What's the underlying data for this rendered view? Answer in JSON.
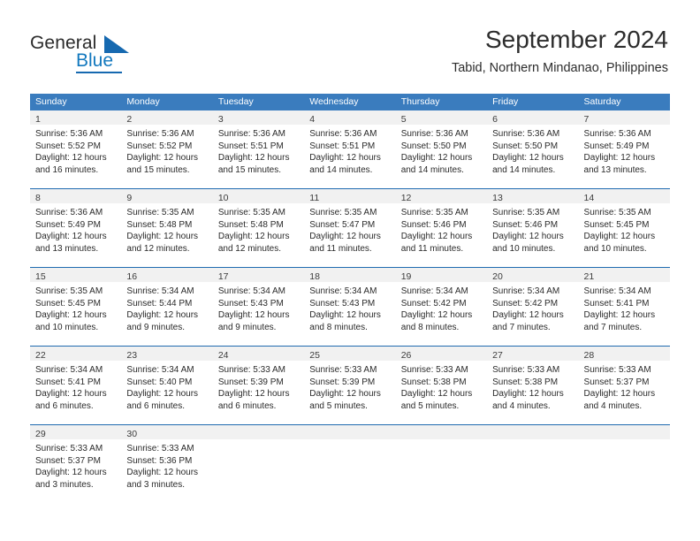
{
  "logo": {
    "word_one": "General",
    "word_two": "Blue",
    "icon": "triangle-icon"
  },
  "header": {
    "month_title": "September 2024",
    "location": "Tabid, Northern Mindanao, Philippines"
  },
  "theme": {
    "header_blue": "#3a7cbe",
    "separator_blue": "#1f6bb0",
    "day_band_gray": "#f1f1f1",
    "logo_blue": "#1278be",
    "text": "#2a2a2a"
  },
  "calendar": {
    "weekdays": [
      "Sunday",
      "Monday",
      "Tuesday",
      "Wednesday",
      "Thursday",
      "Friday",
      "Saturday"
    ],
    "weeks": [
      [
        {
          "day": "1",
          "sunrise": "Sunrise: 5:36 AM",
          "sunset": "Sunset: 5:52 PM",
          "daylight_1": "Daylight: 12 hours",
          "daylight_2": "and 16 minutes."
        },
        {
          "day": "2",
          "sunrise": "Sunrise: 5:36 AM",
          "sunset": "Sunset: 5:52 PM",
          "daylight_1": "Daylight: 12 hours",
          "daylight_2": "and 15 minutes."
        },
        {
          "day": "3",
          "sunrise": "Sunrise: 5:36 AM",
          "sunset": "Sunset: 5:51 PM",
          "daylight_1": "Daylight: 12 hours",
          "daylight_2": "and 15 minutes."
        },
        {
          "day": "4",
          "sunrise": "Sunrise: 5:36 AM",
          "sunset": "Sunset: 5:51 PM",
          "daylight_1": "Daylight: 12 hours",
          "daylight_2": "and 14 minutes."
        },
        {
          "day": "5",
          "sunrise": "Sunrise: 5:36 AM",
          "sunset": "Sunset: 5:50 PM",
          "daylight_1": "Daylight: 12 hours",
          "daylight_2": "and 14 minutes."
        },
        {
          "day": "6",
          "sunrise": "Sunrise: 5:36 AM",
          "sunset": "Sunset: 5:50 PM",
          "daylight_1": "Daylight: 12 hours",
          "daylight_2": "and 14 minutes."
        },
        {
          "day": "7",
          "sunrise": "Sunrise: 5:36 AM",
          "sunset": "Sunset: 5:49 PM",
          "daylight_1": "Daylight: 12 hours",
          "daylight_2": "and 13 minutes."
        }
      ],
      [
        {
          "day": "8",
          "sunrise": "Sunrise: 5:36 AM",
          "sunset": "Sunset: 5:49 PM",
          "daylight_1": "Daylight: 12 hours",
          "daylight_2": "and 13 minutes."
        },
        {
          "day": "9",
          "sunrise": "Sunrise: 5:35 AM",
          "sunset": "Sunset: 5:48 PM",
          "daylight_1": "Daylight: 12 hours",
          "daylight_2": "and 12 minutes."
        },
        {
          "day": "10",
          "sunrise": "Sunrise: 5:35 AM",
          "sunset": "Sunset: 5:48 PM",
          "daylight_1": "Daylight: 12 hours",
          "daylight_2": "and 12 minutes."
        },
        {
          "day": "11",
          "sunrise": "Sunrise: 5:35 AM",
          "sunset": "Sunset: 5:47 PM",
          "daylight_1": "Daylight: 12 hours",
          "daylight_2": "and 11 minutes."
        },
        {
          "day": "12",
          "sunrise": "Sunrise: 5:35 AM",
          "sunset": "Sunset: 5:46 PM",
          "daylight_1": "Daylight: 12 hours",
          "daylight_2": "and 11 minutes."
        },
        {
          "day": "13",
          "sunrise": "Sunrise: 5:35 AM",
          "sunset": "Sunset: 5:46 PM",
          "daylight_1": "Daylight: 12 hours",
          "daylight_2": "and 10 minutes."
        },
        {
          "day": "14",
          "sunrise": "Sunrise: 5:35 AM",
          "sunset": "Sunset: 5:45 PM",
          "daylight_1": "Daylight: 12 hours",
          "daylight_2": "and 10 minutes."
        }
      ],
      [
        {
          "day": "15",
          "sunrise": "Sunrise: 5:35 AM",
          "sunset": "Sunset: 5:45 PM",
          "daylight_1": "Daylight: 12 hours",
          "daylight_2": "and 10 minutes."
        },
        {
          "day": "16",
          "sunrise": "Sunrise: 5:34 AM",
          "sunset": "Sunset: 5:44 PM",
          "daylight_1": "Daylight: 12 hours",
          "daylight_2": "and 9 minutes."
        },
        {
          "day": "17",
          "sunrise": "Sunrise: 5:34 AM",
          "sunset": "Sunset: 5:43 PM",
          "daylight_1": "Daylight: 12 hours",
          "daylight_2": "and 9 minutes."
        },
        {
          "day": "18",
          "sunrise": "Sunrise: 5:34 AM",
          "sunset": "Sunset: 5:43 PM",
          "daylight_1": "Daylight: 12 hours",
          "daylight_2": "and 8 minutes."
        },
        {
          "day": "19",
          "sunrise": "Sunrise: 5:34 AM",
          "sunset": "Sunset: 5:42 PM",
          "daylight_1": "Daylight: 12 hours",
          "daylight_2": "and 8 minutes."
        },
        {
          "day": "20",
          "sunrise": "Sunrise: 5:34 AM",
          "sunset": "Sunset: 5:42 PM",
          "daylight_1": "Daylight: 12 hours",
          "daylight_2": "and 7 minutes."
        },
        {
          "day": "21",
          "sunrise": "Sunrise: 5:34 AM",
          "sunset": "Sunset: 5:41 PM",
          "daylight_1": "Daylight: 12 hours",
          "daylight_2": "and 7 minutes."
        }
      ],
      [
        {
          "day": "22",
          "sunrise": "Sunrise: 5:34 AM",
          "sunset": "Sunset: 5:41 PM",
          "daylight_1": "Daylight: 12 hours",
          "daylight_2": "and 6 minutes."
        },
        {
          "day": "23",
          "sunrise": "Sunrise: 5:34 AM",
          "sunset": "Sunset: 5:40 PM",
          "daylight_1": "Daylight: 12 hours",
          "daylight_2": "and 6 minutes."
        },
        {
          "day": "24",
          "sunrise": "Sunrise: 5:33 AM",
          "sunset": "Sunset: 5:39 PM",
          "daylight_1": "Daylight: 12 hours",
          "daylight_2": "and 6 minutes."
        },
        {
          "day": "25",
          "sunrise": "Sunrise: 5:33 AM",
          "sunset": "Sunset: 5:39 PM",
          "daylight_1": "Daylight: 12 hours",
          "daylight_2": "and 5 minutes."
        },
        {
          "day": "26",
          "sunrise": "Sunrise: 5:33 AM",
          "sunset": "Sunset: 5:38 PM",
          "daylight_1": "Daylight: 12 hours",
          "daylight_2": "and 5 minutes."
        },
        {
          "day": "27",
          "sunrise": "Sunrise: 5:33 AM",
          "sunset": "Sunset: 5:38 PM",
          "daylight_1": "Daylight: 12 hours",
          "daylight_2": "and 4 minutes."
        },
        {
          "day": "28",
          "sunrise": "Sunrise: 5:33 AM",
          "sunset": "Sunset: 5:37 PM",
          "daylight_1": "Daylight: 12 hours",
          "daylight_2": "and 4 minutes."
        }
      ],
      [
        {
          "day": "29",
          "sunrise": "Sunrise: 5:33 AM",
          "sunset": "Sunset: 5:37 PM",
          "daylight_1": "Daylight: 12 hours",
          "daylight_2": "and 3 minutes."
        },
        {
          "day": "30",
          "sunrise": "Sunrise: 5:33 AM",
          "sunset": "Sunset: 5:36 PM",
          "daylight_1": "Daylight: 12 hours",
          "daylight_2": "and 3 minutes."
        },
        {
          "day": "",
          "sunrise": "",
          "sunset": "",
          "daylight_1": "",
          "daylight_2": ""
        },
        {
          "day": "",
          "sunrise": "",
          "sunset": "",
          "daylight_1": "",
          "daylight_2": ""
        },
        {
          "day": "",
          "sunrise": "",
          "sunset": "",
          "daylight_1": "",
          "daylight_2": ""
        },
        {
          "day": "",
          "sunrise": "",
          "sunset": "",
          "daylight_1": "",
          "daylight_2": ""
        },
        {
          "day": "",
          "sunrise": "",
          "sunset": "",
          "daylight_1": "",
          "daylight_2": ""
        }
      ]
    ]
  }
}
